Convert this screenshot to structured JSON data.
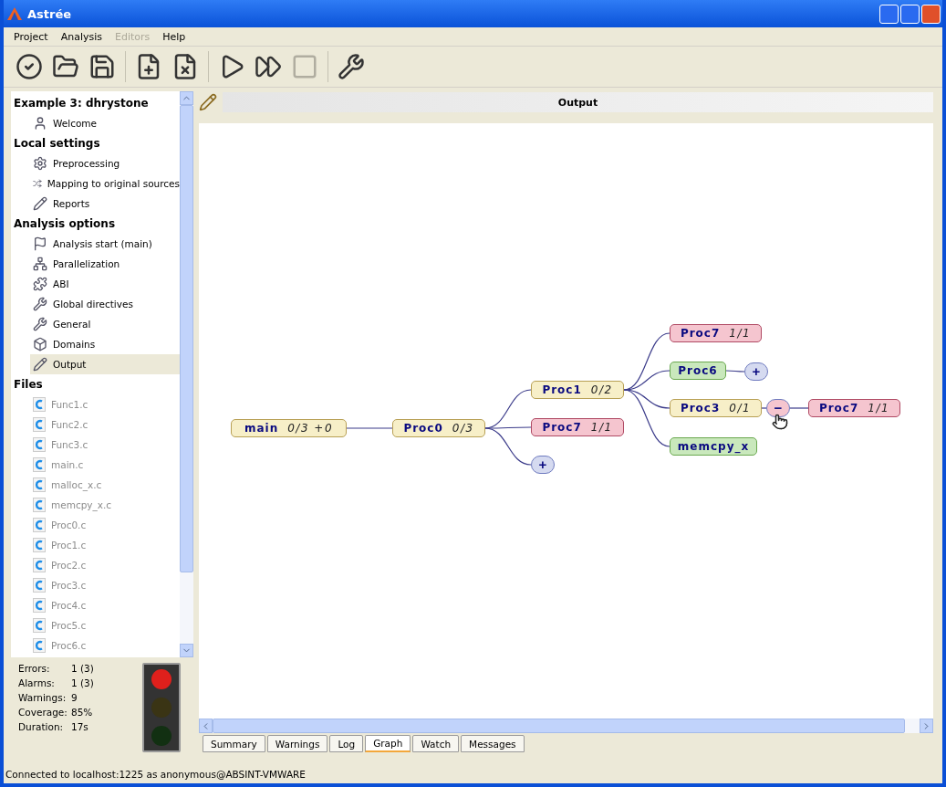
{
  "window": {
    "title": "Astrée"
  },
  "menu": [
    {
      "label": "Project",
      "disabled": false
    },
    {
      "label": "Analysis",
      "disabled": false
    },
    {
      "label": "Editors",
      "disabled": true
    },
    {
      "label": "Help",
      "disabled": false
    }
  ],
  "toolbar": [
    {
      "disabled": false
    },
    {
      "disabled": false
    },
    {
      "disabled": false
    },
    {
      "disabled": false
    },
    {
      "disabled": false
    },
    {
      "disabled": false
    },
    {
      "disabled": false
    },
    {
      "disabled": true
    },
    {
      "disabled": false
    }
  ],
  "sidebar": {
    "sections": [
      {
        "title": "Example 3: dhrystone",
        "items": [
          {
            "label": "Welcome",
            "selected": false,
            "disabled": false
          }
        ]
      },
      {
        "title": "Local settings",
        "items": [
          {
            "label": "Preprocessing",
            "selected": false,
            "disabled": false
          },
          {
            "label": "Mapping to original sources",
            "selected": false,
            "disabled": false
          },
          {
            "label": "Reports",
            "selected": false,
            "disabled": false
          }
        ]
      },
      {
        "title": "Analysis options",
        "items": [
          {
            "label": "Analysis start (main)",
            "selected": false,
            "disabled": false
          },
          {
            "label": "Parallelization",
            "selected": false,
            "disabled": false
          },
          {
            "label": "ABI",
            "selected": false,
            "disabled": false
          },
          {
            "label": "Global directives",
            "selected": false,
            "disabled": false
          },
          {
            "label": "General",
            "selected": false,
            "disabled": false
          },
          {
            "label": "Domains",
            "selected": false,
            "disabled": false
          },
          {
            "label": "Output",
            "selected": true,
            "disabled": false
          }
        ]
      },
      {
        "title": "Files",
        "items": [
          {
            "label": "Func1.c",
            "selected": false,
            "disabled": true
          },
          {
            "label": "Func2.c",
            "selected": false,
            "disabled": true
          },
          {
            "label": "Func3.c",
            "selected": false,
            "disabled": true
          },
          {
            "label": "main.c",
            "selected": false,
            "disabled": true
          },
          {
            "label": "malloc_x.c",
            "selected": false,
            "disabled": true
          },
          {
            "label": "memcpy_x.c",
            "selected": false,
            "disabled": true
          },
          {
            "label": "Proc0.c",
            "selected": false,
            "disabled": true
          },
          {
            "label": "Proc1.c",
            "selected": false,
            "disabled": true
          },
          {
            "label": "Proc2.c",
            "selected": false,
            "disabled": true
          },
          {
            "label": "Proc3.c",
            "selected": false,
            "disabled": true
          },
          {
            "label": "Proc4.c",
            "selected": false,
            "disabled": true
          },
          {
            "label": "Proc5.c",
            "selected": false,
            "disabled": true
          },
          {
            "label": "Proc6.c",
            "selected": false,
            "disabled": true
          }
        ]
      }
    ]
  },
  "stats": [
    {
      "label": "Errors:",
      "value": "1 (3)"
    },
    {
      "label": "Alarms:",
      "value": "1 (3)"
    },
    {
      "label": "Warnings:",
      "value": "9"
    },
    {
      "label": "Coverage:",
      "value": "85%"
    },
    {
      "label": "Duration:",
      "value": "17s"
    }
  ],
  "traffic_light": {
    "lamps": [
      {
        "on": true
      },
      {
        "on": false
      },
      {
        "on": false
      }
    ]
  },
  "output": {
    "title": "Output"
  },
  "graph": {
    "root": {
      "kind": "function",
      "name": "main",
      "ratio": "0/3 +0",
      "color": "#f7efc8",
      "children": [
        {
          "kind": "function",
          "name": "Proc0",
          "ratio": "0/3",
          "color": "#f7efc8",
          "children": [
            {
              "kind": "function",
              "name": "Proc1",
              "ratio": "0/2",
              "color": "#f7efc8",
              "children": [
                {
                  "kind": "function",
                  "name": "Proc7",
                  "ratio": "1/1",
                  "color": "#f5c5cf"
                },
                {
                  "kind": "function",
                  "name": "Proc6",
                  "color": "#c9e8bc",
                  "children": [
                    {
                      "kind": "toggle",
                      "label": "+",
                      "color": "#d5daf0"
                    }
                  ]
                },
                {
                  "kind": "function",
                  "name": "Proc3",
                  "ratio": "0/1",
                  "color": "#f7efc8",
                  "children": [
                    {
                      "kind": "toggle",
                      "label": "−",
                      "color": "#f5c5cf",
                      "children": [
                        {
                          "kind": "function",
                          "name": "Proc7",
                          "ratio": "1/1",
                          "color": "#f5c5cf"
                        }
                      ]
                    }
                  ]
                },
                {
                  "kind": "function",
                  "name": "memcpy_x",
                  "color": "#c9e8bc"
                }
              ]
            },
            {
              "kind": "function",
              "name": "Proc7",
              "ratio": "1/1",
              "color": "#f5c5cf"
            },
            {
              "kind": "toggle",
              "label": "+",
              "color": "#d5daf0"
            }
          ]
        }
      ]
    }
  },
  "tabs": [
    {
      "label": "Summary",
      "selected": false
    },
    {
      "label": "Warnings",
      "selected": false
    },
    {
      "label": "Log",
      "selected": false
    },
    {
      "label": "Graph",
      "selected": true
    },
    {
      "label": "Watch",
      "selected": false
    },
    {
      "label": "Messages",
      "selected": false
    }
  ],
  "status_bar": {
    "text": "Connected to localhost:1225 as anonymous@ABSINT-VMWARE"
  }
}
